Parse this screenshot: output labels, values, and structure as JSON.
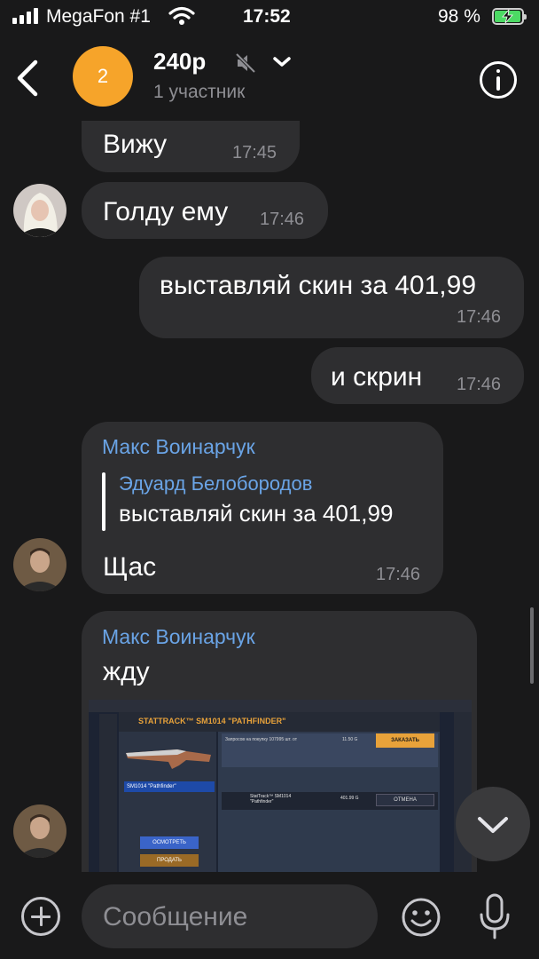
{
  "status_bar": {
    "carrier": "MegaFon #1",
    "time": "17:52",
    "battery": "98 %",
    "battery_level": 0.98
  },
  "header": {
    "avatar_text": "2",
    "title": "240р",
    "subtitle": "1 участник",
    "avatar_color": "#f6a42a"
  },
  "messages": [
    {
      "text": "Вижу",
      "time": "17:45",
      "outgoing": false
    },
    {
      "text": "Голду ему",
      "time": "17:46",
      "outgoing": false
    },
    {
      "text": "выставляй скин за 401,99",
      "time": "17:46",
      "outgoing": true
    },
    {
      "text": "и скрин",
      "time": "17:46",
      "outgoing": true
    },
    {
      "sender": "Макс Воинарчук",
      "reply": {
        "author": "Эдуард Белобородов",
        "text": "выставляй скин за 401,99"
      },
      "text": "Щас",
      "time": "17:46",
      "outgoing": false
    },
    {
      "sender": "Макс Воинарчук",
      "text": "жду",
      "outgoing": false,
      "attachment": {
        "title": "STATTRACK™ SM1014 \"PATHFINDER\"",
        "request_label": "Запросов на покупку 107995 шт. от",
        "price": "11.50 G",
        "buy_button": "ЗАКАЗАТЬ",
        "selected_item": "SM1014 \"Pathfinder\"",
        "row_item_name": "StatTrack™ SM1014",
        "row_item_skin": "\"Pathfinder\"",
        "row_price": "401.99 G",
        "cancel_button": "ОТМЕНА",
        "view_button": "ОСМОТРЕТЬ",
        "sell_button": "ПРОДАТЬ"
      }
    }
  ],
  "composer": {
    "placeholder": "Сообщение"
  },
  "colors": {
    "background": "#19191a",
    "bubble": "#2e2e30",
    "accent_name": "#6aa4e6",
    "battery_green": "#4cd964"
  }
}
